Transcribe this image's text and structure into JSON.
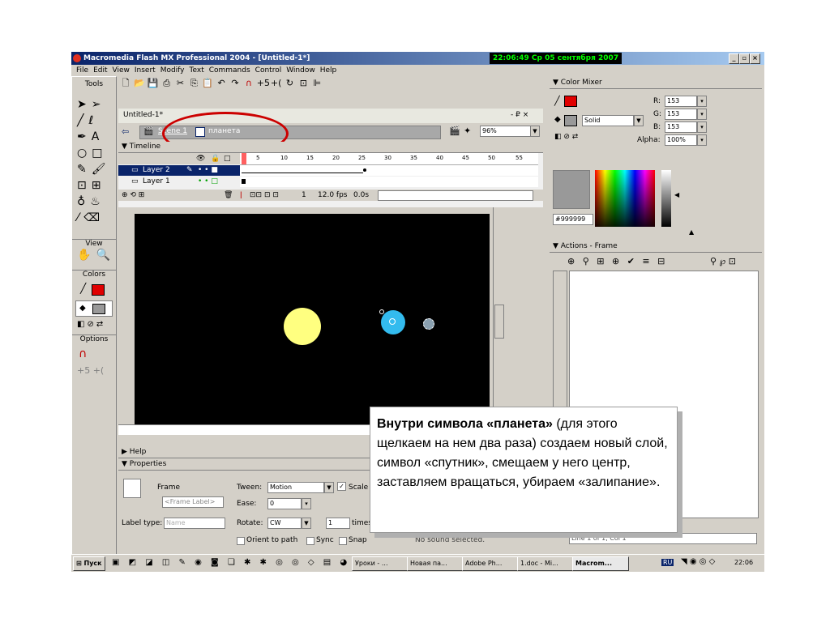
{
  "window": {
    "title": "Macromedia Flash MX Professional 2004 - [Untitled-1*]",
    "clock": "22:06:49  Ср 05 сентября 2007",
    "controls": [
      "_",
      "▫",
      "×"
    ]
  },
  "menu": [
    "File",
    "Edit",
    "View",
    "Insert",
    "Modify",
    "Text",
    "Commands",
    "Control",
    "Window",
    "Help"
  ],
  "tools": {
    "title": "Tools",
    "view_label": "View",
    "colors_label": "Colors",
    "options_label": "Options"
  },
  "document": {
    "tab": "Untitled-1*",
    "close_controls": "- ₽ ×",
    "scene": "Scene 1",
    "symbol": "планета",
    "zoom": "96%"
  },
  "timeline": {
    "title": "Timeline",
    "frame_numbers": [
      "1",
      "5",
      "10",
      "15",
      "20",
      "25",
      "30",
      "35",
      "40",
      "45",
      "50",
      "55"
    ],
    "layers": [
      {
        "name": "Layer 2",
        "selected": true
      },
      {
        "name": "Layer 1",
        "selected": false
      }
    ],
    "current_frame": "1",
    "fps": "12.0 fps",
    "time": "0.0s"
  },
  "color_mixer": {
    "title": "Color Mixer",
    "fill_type": "Solid",
    "r_label": "R:",
    "r": "153",
    "g_label": "G:",
    "g": "153",
    "b_label": "B:",
    "b": "153",
    "alpha_label": "Alpha:",
    "alpha": "100%",
    "hex": "#999999"
  },
  "actions": {
    "title": "Actions - Frame",
    "status": "Line 1 of 1, Col 1"
  },
  "help": {
    "title": "Help"
  },
  "properties": {
    "title": "Properties",
    "frame_label": "Frame",
    "frame_placeholder": "<Frame Label>",
    "tween_label": "Tween:",
    "tween": "Motion",
    "scale_label": "Scale",
    "ease_label": "Ease:",
    "ease": "0",
    "rotate_label": "Rotate:",
    "rotate": "CW",
    "times_value": "1",
    "times_label": "times",
    "label_type_label": "Label type:",
    "label_type": "Name",
    "orient_label": "Orient to path",
    "sync_label": "Sync",
    "snap_label": "Snap",
    "sound_status": "No sound selected."
  },
  "taskbar": {
    "start": "Пуск",
    "items": [
      "Уроки - ...",
      "Новая па...",
      "Adobe Ph...",
      "1.doc - Mi...",
      "Macrom..."
    ],
    "lang": "RU",
    "time": "22:06"
  },
  "callout": {
    "bold": "Внутри символа «планета»",
    "rest": " (для этого щелкаем на нем два раза) создаем новый слой, символ «спутник», смещаем у него центр, заставляем вращаться, убираем «залипание»."
  },
  "colors": {
    "stage": "#000000",
    "sun": "#ffff80",
    "planet": "#33bbee",
    "highlight_ellipse": "#cc0000",
    "selected_layer": "#0a246a"
  }
}
